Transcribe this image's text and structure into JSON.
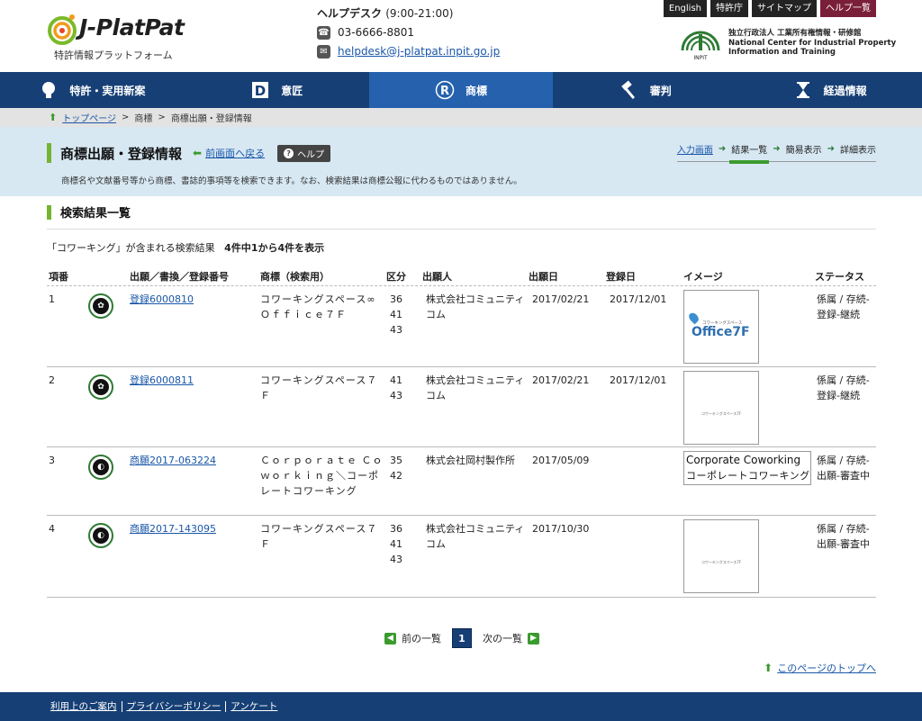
{
  "logo": {
    "name": "J-PlatPat",
    "subtitle": "特許情報プラットフォーム"
  },
  "helpdesk": {
    "title": "ヘルプデスク",
    "hours": "(9:00-21:00)",
    "phone": "03-6666-8801",
    "email": "helpdesk@j-platpat.inpit.go.jp"
  },
  "toplinks": [
    "English",
    "特許庁",
    "サイトマップ",
    "ヘルプ一覧"
  ],
  "inpit": {
    "line1": "独立行政法人 工業所有権情報・研修館",
    "line2": "National Center for Industrial Property",
    "line3": "Information and Training",
    "mark": "INPIT"
  },
  "nav": [
    {
      "label": "特許・実用新案",
      "icon": "lightbulb-icon"
    },
    {
      "label": "意匠",
      "icon": "design-d-icon"
    },
    {
      "label": "商標",
      "icon": "registered-r-icon"
    },
    {
      "label": "審判",
      "icon": "gavel-icon"
    },
    {
      "label": "経過情報",
      "icon": "hourglass-icon"
    }
  ],
  "breadcrumb": [
    "トップページ",
    "商標",
    "商標出願・登録情報"
  ],
  "page": {
    "title": "商標出願・登録情報",
    "back": "前画面へ戻る",
    "help": "ヘルプ",
    "description": "商標名や文献番号等から商標、書誌的事項等を検索できます。なお、検索結果は商標公報に代わるものではありません。"
  },
  "steps": [
    "入力画面",
    "結果一覧",
    "簡易表示",
    "詳細表示"
  ],
  "results": {
    "heading": "検索結果一覧",
    "summary_pre": "「コワーキング」が含まれる検索結果",
    "summary_count": "4件中1から4件を表示",
    "columns": [
      "項番",
      "出願／書換／登録番号",
      "商標（検索用）",
      "区分",
      "出願人",
      "出願日",
      "登録日",
      "イメージ",
      "ステータス"
    ],
    "rows": [
      {
        "no": "1",
        "number": "登録6000810",
        "mark": "コワーキングスペース∞Ｏｆｆｉｃｅ７Ｆ",
        "classes": [
          "36",
          "41",
          "43"
        ],
        "applicant": "株式会社コミュニティコム",
        "filed": "2017/02/21",
        "registered": "2017/12/01",
        "image_small": "コワーキングスペース",
        "image_big": "Office7F",
        "status": "係属 / 存続-登録-継続"
      },
      {
        "no": "2",
        "number": "登録6000811",
        "mark": "コワーキングスペース７Ｆ",
        "classes": [
          "41",
          "43"
        ],
        "applicant": "株式会社コミュニティコム",
        "filed": "2017/02/21",
        "registered": "2017/12/01",
        "image_text": "コワーキングスペース7F",
        "status": "係属 / 存続-登録-継続"
      },
      {
        "no": "3",
        "number": "商願2017-063224",
        "mark": "Ｃｏｒｐｏｒａｔｅ Ｃｏｗｏｒｋｉｎｇ＼コーポレートコワーキング",
        "classes": [
          "35",
          "42"
        ],
        "applicant": "株式会社岡村製作所",
        "filed": "2017/05/09",
        "registered": "",
        "image_en": "Corporate Coworking",
        "image_ja": "コーポレートコワーキング",
        "status": "係属 / 存続-出願-審査中"
      },
      {
        "no": "4",
        "number": "商願2017-143095",
        "mark": "コワーキングスペース７Ｆ",
        "classes": [
          "36",
          "41",
          "43"
        ],
        "applicant": "株式会社コミュニティコム",
        "filed": "2017/10/30",
        "registered": "",
        "image_text": "コワーキングスペース7F",
        "status": "係属 / 存続-出願-審査中"
      }
    ]
  },
  "pager": {
    "prev": "前の一覧",
    "current": "1",
    "next": "次の一覧"
  },
  "pagetop": "このページのトップへ",
  "footer": [
    "利用上のご案内",
    "プライバシーポリシー",
    "アンケート"
  ],
  "colors": {
    "nav": "#163f75",
    "nav_active": "#2561ad",
    "accent_green": "#74b52f",
    "band": "#d7e8f3"
  }
}
